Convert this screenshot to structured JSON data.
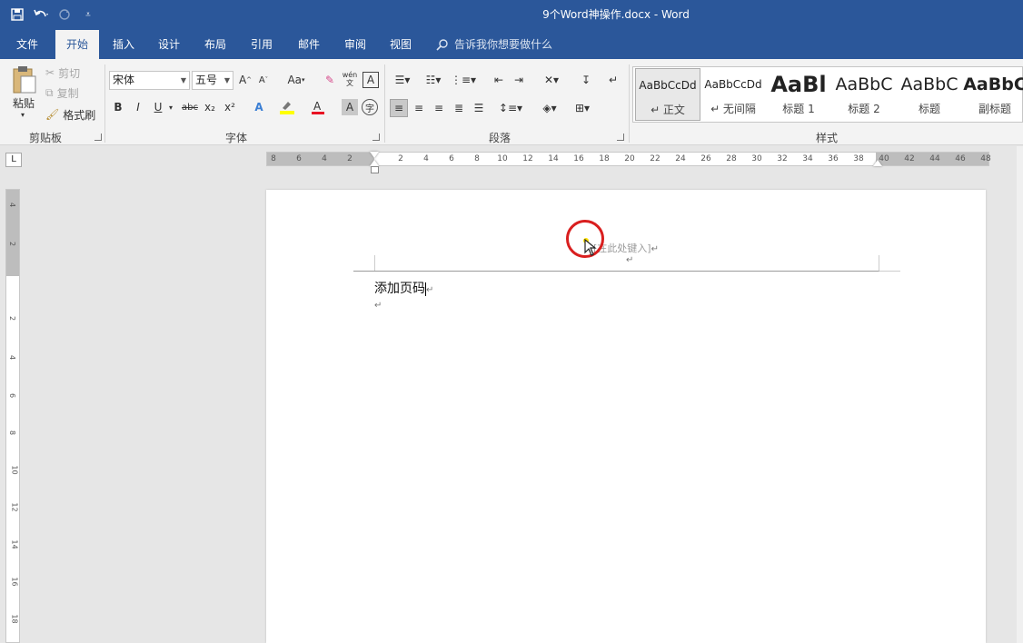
{
  "window": {
    "doc_title": "9个Word神操作.docx  -  Word"
  },
  "qat": {
    "save_icon": "save-icon",
    "undo_icon": "undo-icon",
    "redo_icon": "redo-icon",
    "customize_icon": "customize-qat-icon"
  },
  "tabs": [
    {
      "label": "文件"
    },
    {
      "label": "开始",
      "active": true
    },
    {
      "label": "插入"
    },
    {
      "label": "设计"
    },
    {
      "label": "布局"
    },
    {
      "label": "引用"
    },
    {
      "label": "邮件"
    },
    {
      "label": "审阅"
    },
    {
      "label": "视图"
    }
  ],
  "tell_me": "告诉我你想要做什么",
  "clipboard": {
    "paste": "粘贴",
    "cut": "剪切",
    "copy": "复制",
    "format_painter": "格式刷",
    "label": "剪贴板"
  },
  "font": {
    "name": "宋体",
    "size": "五号",
    "label": "字体",
    "grow": "A",
    "shrink": "A",
    "case": "Aa",
    "bold": "B",
    "italic": "I",
    "underline": "U",
    "strike": "abc",
    "sub": "x₂",
    "sup": "x²",
    "phonetic": "wén",
    "highlight_color": "#ffff00",
    "font_color": "#e81123"
  },
  "paragraph": {
    "label": "段落"
  },
  "styles": {
    "label": "样式",
    "items": [
      {
        "preview": "AaBbCcDd",
        "name": "↵ 正文",
        "selected": true
      },
      {
        "preview": "AaBbCcDd",
        "name": "↵ 无间隔"
      },
      {
        "preview": "AaBl",
        "name": "标题 1"
      },
      {
        "preview": "AaBbC",
        "name": "标题 2"
      },
      {
        "preview": "AaBbC",
        "name": "标题"
      },
      {
        "preview": "AaBbC",
        "name": "副标题"
      }
    ]
  },
  "ruler": {
    "ticks": [
      "8",
      "6",
      "4",
      "2",
      "2",
      "4",
      "6",
      "8",
      "10",
      "12",
      "14",
      "16",
      "18",
      "20",
      "22",
      "24",
      "26",
      "28",
      "30",
      "32",
      "34",
      "36",
      "38",
      "40",
      "42",
      "44",
      "46",
      "48"
    ],
    "vticks": [
      "4",
      "2",
      "2",
      "4",
      "6",
      "8",
      "10",
      "12",
      "14",
      "16",
      "18"
    ],
    "tab_selector": "L"
  },
  "document": {
    "header_placeholder": "[在此处键入]",
    "body_text": "添加页码",
    "paragraph_mark": "↵"
  }
}
